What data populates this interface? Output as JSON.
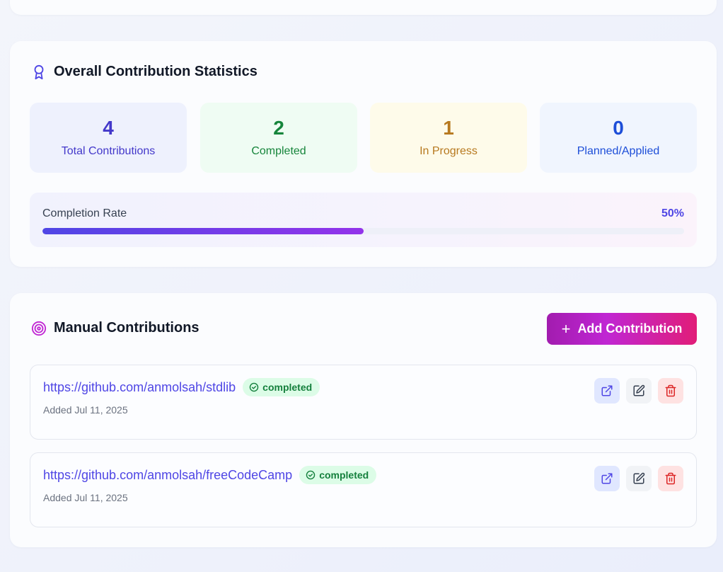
{
  "stats_section": {
    "title": "Overall Contribution Statistics",
    "icon": "award-icon",
    "cards": [
      {
        "value": "4",
        "label": "Total Contributions",
        "color": "#4338ca"
      },
      {
        "value": "2",
        "label": "Completed",
        "color": "#16853b"
      },
      {
        "value": "1",
        "label": "In Progress",
        "color": "#b7791f"
      },
      {
        "value": "0",
        "label": "Planned/Applied",
        "color": "#1d4ed8"
      }
    ],
    "completion": {
      "label": "Completion Rate",
      "percent_text": "50%",
      "percent": 50
    }
  },
  "manual_section": {
    "title": "Manual Contributions",
    "icon": "target-icon",
    "add_button": "Add Contribution",
    "items": [
      {
        "url": "https://github.com/anmolsah/stdlib",
        "status": "completed",
        "added": "Added Jul 11, 2025"
      },
      {
        "url": "https://github.com/anmolsah/freeCodeCamp",
        "status": "completed",
        "added": "Added Jul 11, 2025"
      }
    ]
  },
  "colors": {
    "accent": "#4f46e5",
    "add_gradient_start": "#a21caf",
    "add_gradient_end": "#e11d78",
    "status_green": "#15803d",
    "delete_red": "#dc2626"
  }
}
